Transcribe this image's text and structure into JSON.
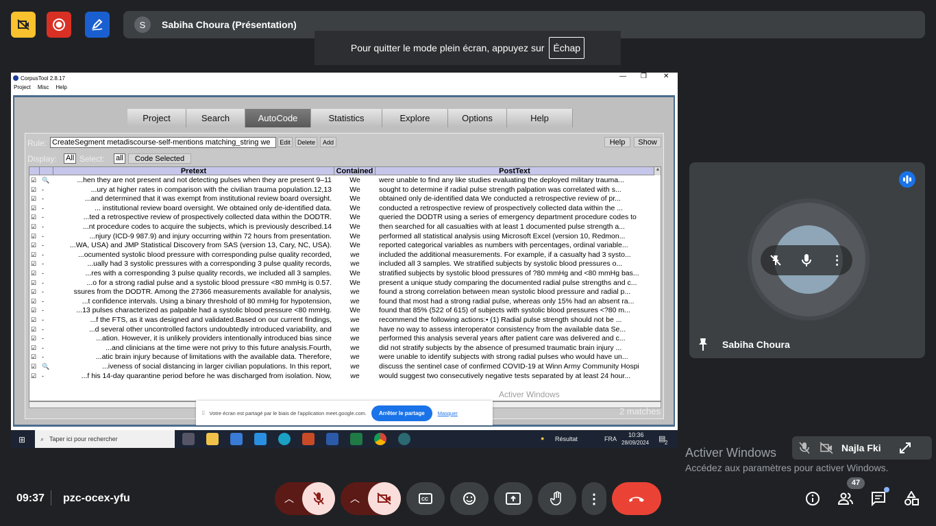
{
  "top": {
    "presenter_initial": "S",
    "presenter_label": "Sabiha Choura (Présentation)",
    "fullscreen_msg": "Pour quitter le mode plein écran, appuyez sur",
    "esc_key": "Échap"
  },
  "window": {
    "title": "CorpusTool 2.8.17",
    "menu": [
      "Project",
      "Misc",
      "Help"
    ],
    "tabs": [
      "Project",
      "Search",
      "AutoCode",
      "Statistics",
      "Explore",
      "Options",
      "Help"
    ],
    "active_tab": "AutoCode",
    "rule_label": "Rule:",
    "rule_value": "CreateSegment metadiscourse-self-mentions matching_string  we",
    "rule_buttons": [
      "Edit",
      "Delete",
      "Add"
    ],
    "right_buttons": [
      "Help",
      "Show"
    ],
    "display_label": "Display:",
    "display_value": "All",
    "select_label": "Select:",
    "select_value": "all",
    "code_selected": "Code Selected",
    "columns": [
      "Pretext",
      "Contained",
      "PostText"
    ],
    "rows": [
      {
        "mark": "🔍",
        "pre": "...hen they are not present and not detecting pulses when they are present 9–11",
        "con": "We",
        "post": "were unable to find any like studies evaluating the deployed military trauma..."
      },
      {
        "mark": "-",
        "pre": "...ury at higher rates in comparison with the civilian trauma population.12,13",
        "con": "We",
        "post": "sought to determine if radial pulse strength palpation was correlated with s..."
      },
      {
        "mark": "-",
        "pre": "...and determined that it was exempt from institutional review board oversight.",
        "con": "We",
        "post": "obtained only de-identified data We conducted a retrospective review of pr..."
      },
      {
        "mark": "-",
        "pre": "... institutional review board oversight. We obtained only de-identified data.",
        "con": "We",
        "post": "conducted a retrospective review of prospectively collected data within the ..."
      },
      {
        "mark": "-",
        "pre": "...ted a retrospective review of prospectively collected data within the DODTR.",
        "con": "We",
        "post": "queried the DODTR using a series of emergency department procedure codes to"
      },
      {
        "mark": "-",
        "pre": "...nt procedure codes to acquire the subjects, which is previously described.14",
        "con": "We",
        "post": "then searched for all casualties with at least 1 documented pulse strength a..."
      },
      {
        "mark": "-",
        "pre": "...njury (ICD-9 987.9) and injury occurring within 72 hours from presentation.",
        "con": "We",
        "post": "performed all statistical analysis using Microsoft Excel (version 10, Redmon..."
      },
      {
        "mark": "-",
        "pre": "...WA, USA) and JMP Statistical Discovery from SAS (version 13, Cary, NC, USA).",
        "con": "We",
        "post": "reported categorical variables as numbers with percentages, ordinal variable..."
      },
      {
        "mark": "-",
        "pre": "...ocumented systolic blood pressure with corresponding pulse quality recorded,",
        "con": "we",
        "post": "included the additional measurements. For example, if a casualty had 3 systo..."
      },
      {
        "mark": "-",
        "pre": "...ually had 3 systolic pressures with a corresponding 3 pulse quality records,",
        "con": "we",
        "post": "included all 3 samples. We stratified subjects by systolic blood pressures o..."
      },
      {
        "mark": "-",
        "pre": "...res with a corresponding 3 pulse quality records, we included all 3 samples.",
        "con": "We",
        "post": "stratified subjects by systolic blood pressures of ?80 mmHg and <80 mmHg bas..."
      },
      {
        "mark": "-",
        "pre": "...o for a strong radial pulse and a systolic blood pressure <80 mmHg is 0.57.",
        "con": "We",
        "post": "present a unique study comparing the documented radial pulse strengths and c..."
      },
      {
        "mark": "-",
        "pre": "ssures from the DODTR. Among the 27366 measurements available for analysis,",
        "con": "we",
        "post": "found a strong correlation between mean systolic blood pressure and radial p..."
      },
      {
        "mark": "-",
        "pre": "...t confidence intervals. Using a binary threshold of 80 mmHg for hypotension,",
        "con": "we",
        "post": "found that most had a strong radial pulse, whereas only 15% had an absent ra..."
      },
      {
        "mark": "-",
        "pre": "...13 pulses characterized as palpable had a systolic blood pressure <80 mmHg.",
        "con": "We",
        "post": "found that 85% (522 of 615) of subjects with systolic blood pressures <?80 m..."
      },
      {
        "mark": "-",
        "pre": "...f the FTS, as it was designed and validated.Based on our current findings,",
        "con": "we",
        "post": "recommend the following actions:• (1) Radial pulse strength should not be ..."
      },
      {
        "mark": "-",
        "pre": "...d several other uncontrolled factors undoubtedly introduced variability, and",
        "con": "we",
        "post": "have no way to assess interoperator consistency from the available data Se..."
      },
      {
        "mark": "-",
        "pre": "...ation. However, it is unlikely providers intentionally introduced bias since",
        "con": "we",
        "post": "performed this analysis several years after patient care was delivered and c..."
      },
      {
        "mark": "-",
        "pre": "...and clinicians at the time were not privy to this future analysis.Fourth,",
        "con": "we",
        "post": "did not stratify subjects by the absence of presumed traumatic brain injury ..."
      },
      {
        "mark": "-",
        "pre": "...atic brain injury because of limitations with the available data. Therefore,",
        "con": "we",
        "post": "were unable to identify subjects with strong radial pulses who would have un..."
      },
      {
        "mark": "🔍",
        "pre": "...iveness of social distancing in larger civilian populations. In this report,",
        "con": "we",
        "post": "discuss the sentinel case of confirmed COVID-19 at Winn Army Community Hospi"
      },
      {
        "mark": "-",
        "pre": "...f his 14-day quarantine period before he was discharged from isolation. Now,",
        "con": "we",
        "post": "would suggest two consecutively negative tests separated by at least 24 hour..."
      }
    ],
    "matches": "2 matches",
    "activate_overlay": "Activer Windows"
  },
  "sharebar": {
    "msg": "Votre écran est partagé par le biais de l'application meet.google.com.",
    "stop": "Arrêter le partage",
    "hide": "Masquer"
  },
  "taskbar": {
    "search": "Taper ici pour rechercher",
    "weather": "Résultat",
    "lang": "FRA",
    "time": "10:36",
    "date": "28/09/2024",
    "notif": "2"
  },
  "tile": {
    "name": "Sabiha Choura"
  },
  "mini": {
    "name": "Najla Fki"
  },
  "activate": {
    "title": "Activer Windows",
    "sub": "Accédez aux paramètres pour activer Windows."
  },
  "bottom": {
    "time": "09:37",
    "code": "pzc-ocex-yfu",
    "participants": "47"
  },
  "colors": {
    "end_call": "#ea4335",
    "muted_bg": "#f9dedc",
    "muted_dark": "#8c1d18",
    "accent": "#1a73e8"
  }
}
